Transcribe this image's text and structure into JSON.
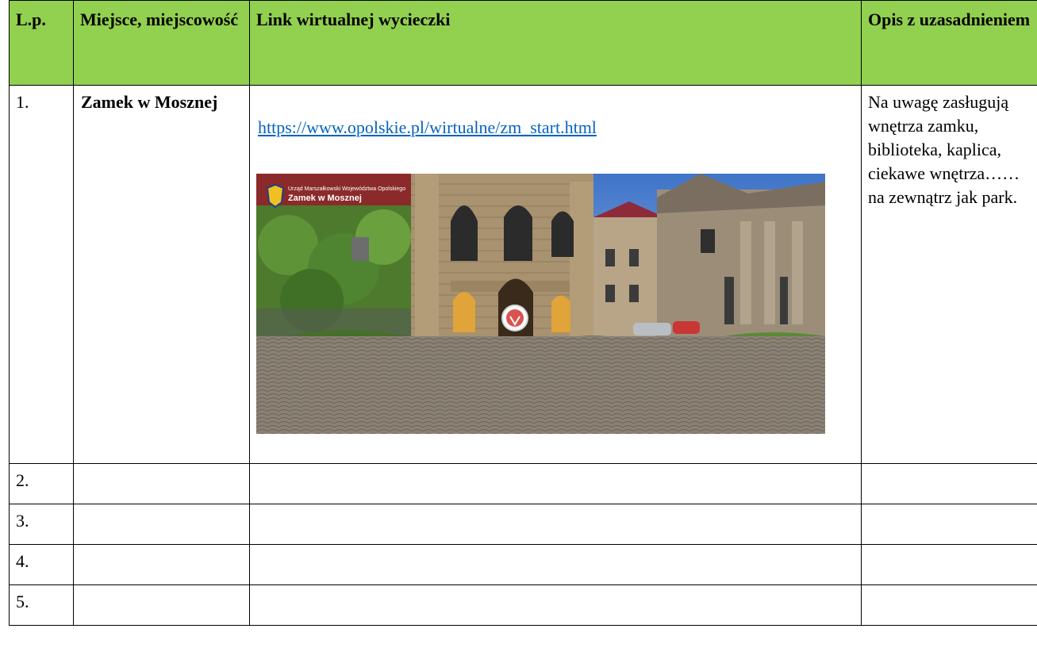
{
  "table": {
    "headers": [
      "L.p.",
      "Miejsce, miejscowość",
      "Link wirtualnej wycieczki",
      "Opis z uzasadnieniem"
    ],
    "rows": [
      {
        "no": "1.",
        "place": "Zamek w Mosznej",
        "link": "https://www.opolskie.pl/wirtualne/zm_start.html",
        "description": "Na uwagę zasługują wnętrza zamku, biblioteka, kaplica, ciekawe wnętrza…… na zewnątrz jak park.",
        "image": {
          "alt": "castle-panorama-photo",
          "overlay_title": "Zamek w Mosznej",
          "overlay_subtitle": "Urząd Marszałkowski Województwa Opolskiego"
        }
      },
      {
        "no": "2.",
        "place": "",
        "link": "",
        "description": ""
      },
      {
        "no": "3.",
        "place": "",
        "link": "",
        "description": ""
      },
      {
        "no": "4.",
        "place": "",
        "link": "",
        "description": ""
      },
      {
        "no": "5.",
        "place": "",
        "link": "",
        "description": ""
      }
    ]
  },
  "colors": {
    "header_bg": "#92d050",
    "link": "#0563c1",
    "border": "#000000"
  }
}
